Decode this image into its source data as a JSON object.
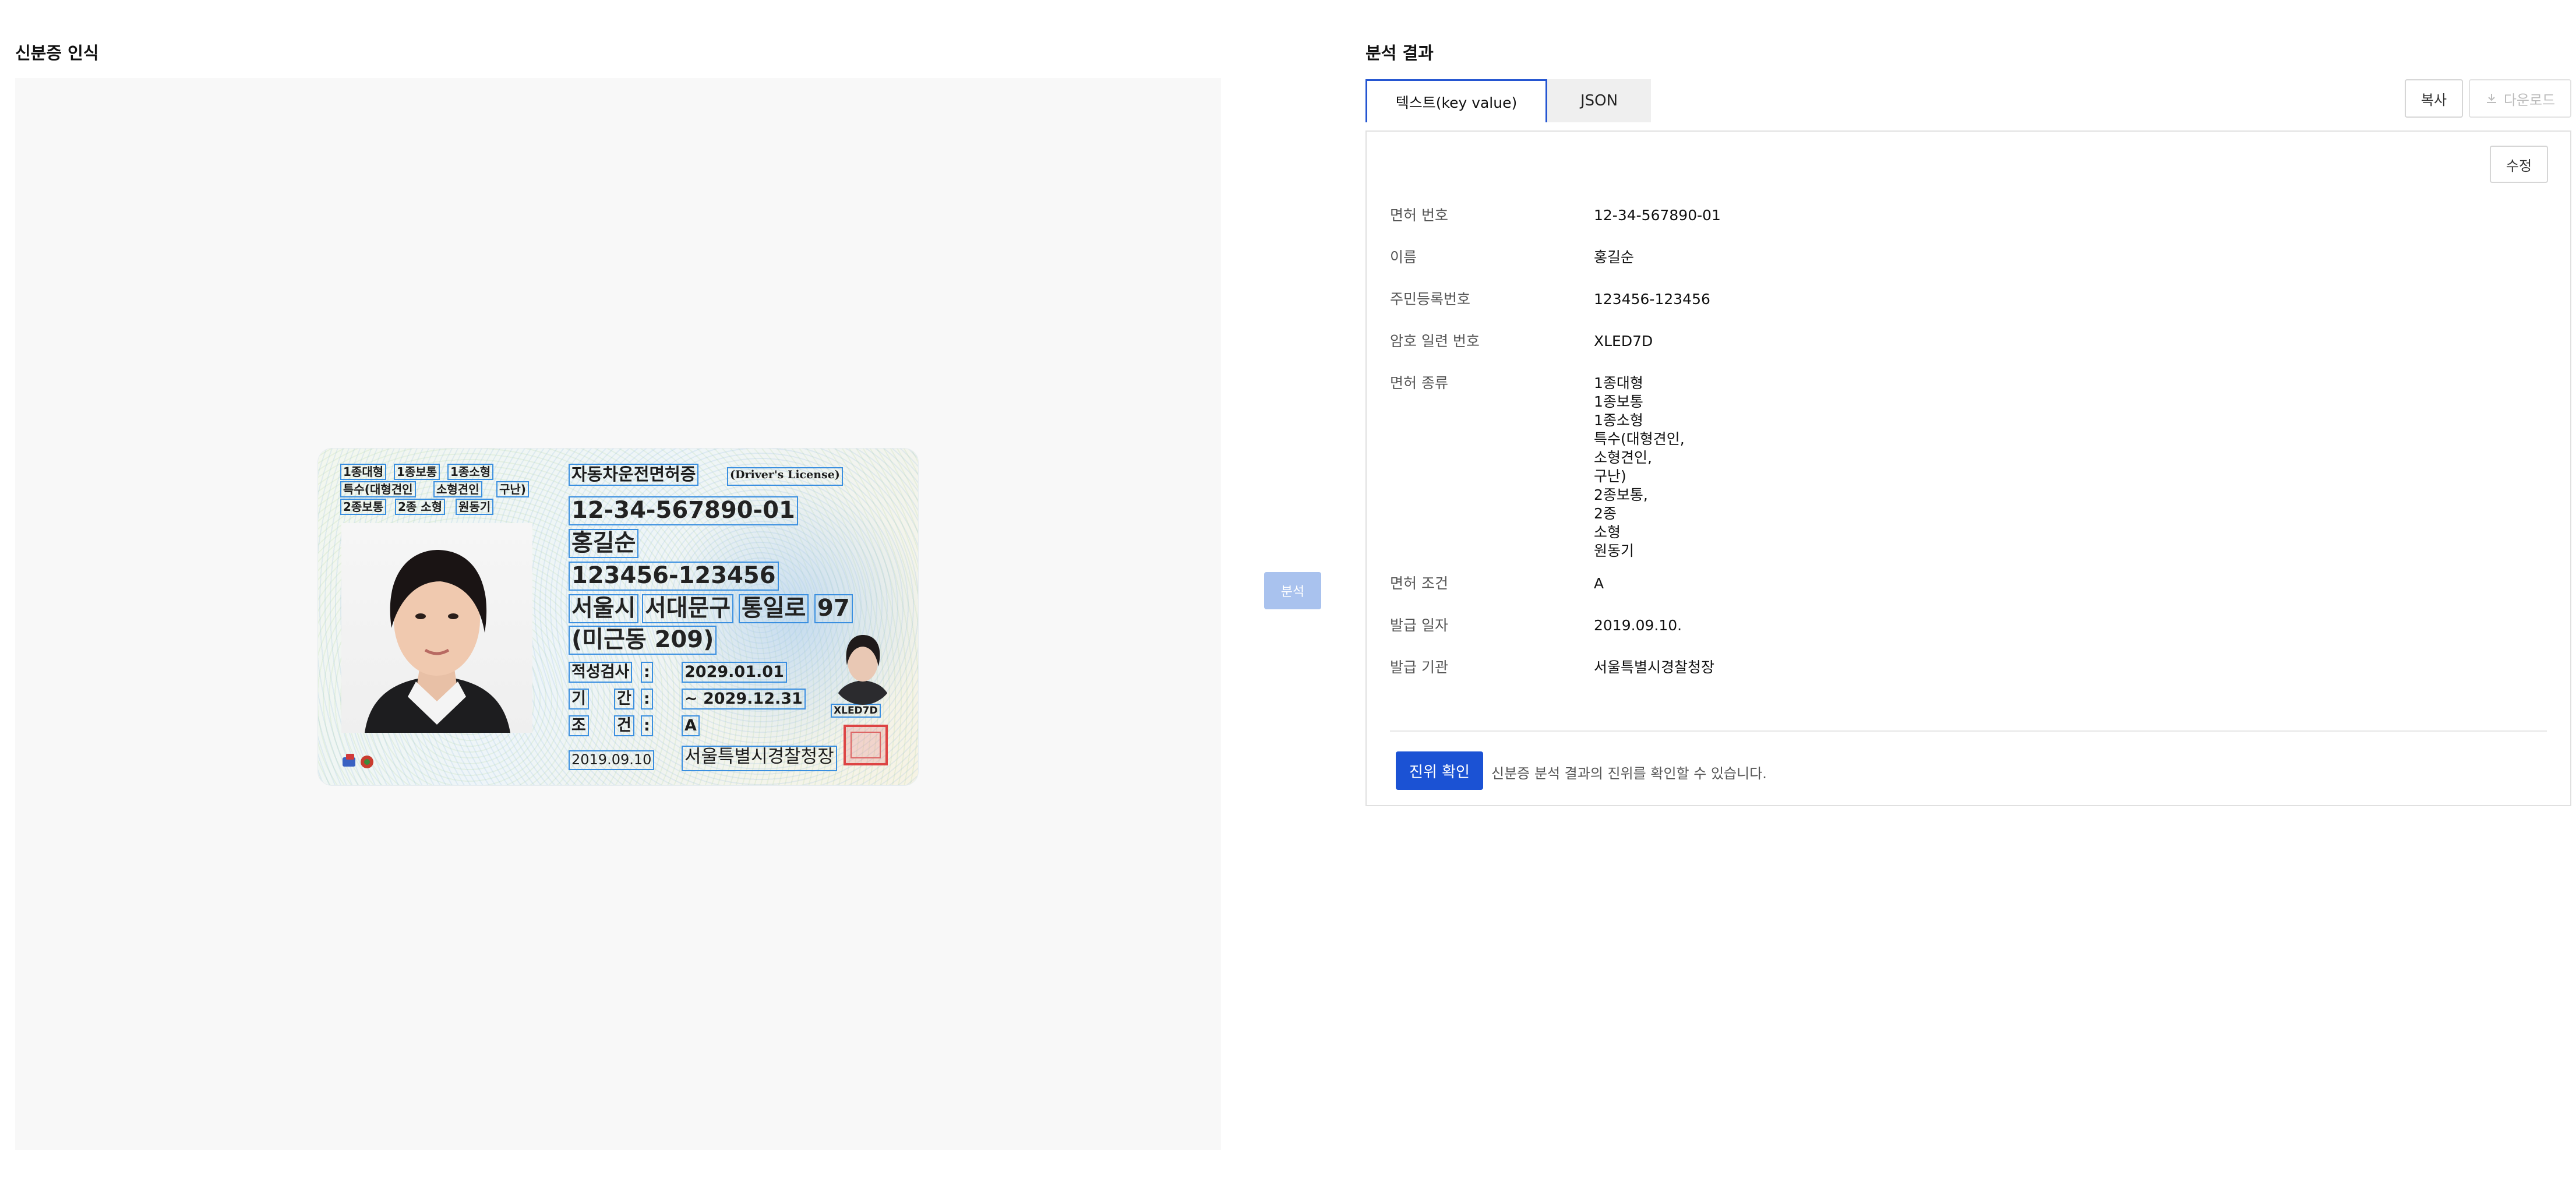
{
  "left_section": {
    "title": "신분증 인식"
  },
  "right_section": {
    "title": "분석 결과"
  },
  "card": {
    "license_types": [
      "1종대형",
      "1종보통",
      "1종소형",
      "특수(대형견인",
      "소형견인",
      "구난)",
      "2종보통",
      "2종 소형",
      "원동기"
    ],
    "card_title": "자동차운전면허증",
    "card_title_en": "(Driver's License)",
    "license_number": "12-34-567890-01",
    "name": "홍길순",
    "resident_number": "123456-123456",
    "address_parts": [
      "서울시",
      "서대문구",
      "통일로",
      "97"
    ],
    "address_line2": "(미근동 209)",
    "aptitude_label": "적성검사",
    "colon": ":",
    "aptitude_date": "2029.01.01",
    "period_label_1": "기",
    "period_label_2": "간",
    "period_value": "~ 2029.12.31",
    "condition_label_1": "조",
    "condition_label_2": "건",
    "condition_value": "A",
    "serial": "XLED7D",
    "issue_date": "2019.09.10",
    "issuer": "서울특별시경찰청장"
  },
  "analyze_button": {
    "label": "분석"
  },
  "tabs": [
    {
      "label": "텍스트(key value)",
      "active": true
    },
    {
      "label": "JSON",
      "active": false
    }
  ],
  "toolbar": {
    "copy_label": "복사",
    "download_label": "다운로드"
  },
  "result": {
    "edit_label": "수정",
    "fields": [
      {
        "key": "면허 번호",
        "value": "12-34-567890-01"
      },
      {
        "key": "이름",
        "value": "홍길순"
      },
      {
        "key": "주민등록번호",
        "value": "123456-123456"
      },
      {
        "key": "암호 일련 번호",
        "value": "XLED7D"
      },
      {
        "key": "면허 종류",
        "value": "1종대형\n1종보통\n1종소형\n특수(대형견인,\n소형견인,\n구난)\n2종보통,\n2종\n소형\n원동기"
      },
      {
        "key": "면허 조건",
        "value": "A"
      },
      {
        "key": "발급 일자",
        "value": "2019.09.10."
      },
      {
        "key": "발급 기관",
        "value": "서울특별시경찰청장"
      }
    ]
  },
  "verify": {
    "button_label": "진위 확인",
    "description": "신분증 분석 결과의 진위를 확인할 수 있습니다."
  },
  "colors": {
    "primary": "#1b52d4",
    "active_tab_border": "#2455d1",
    "analyze_disabled": "#a9c2ee",
    "ocr_box": "#3a8fe0",
    "panel_bg": "#f8f8f8"
  }
}
